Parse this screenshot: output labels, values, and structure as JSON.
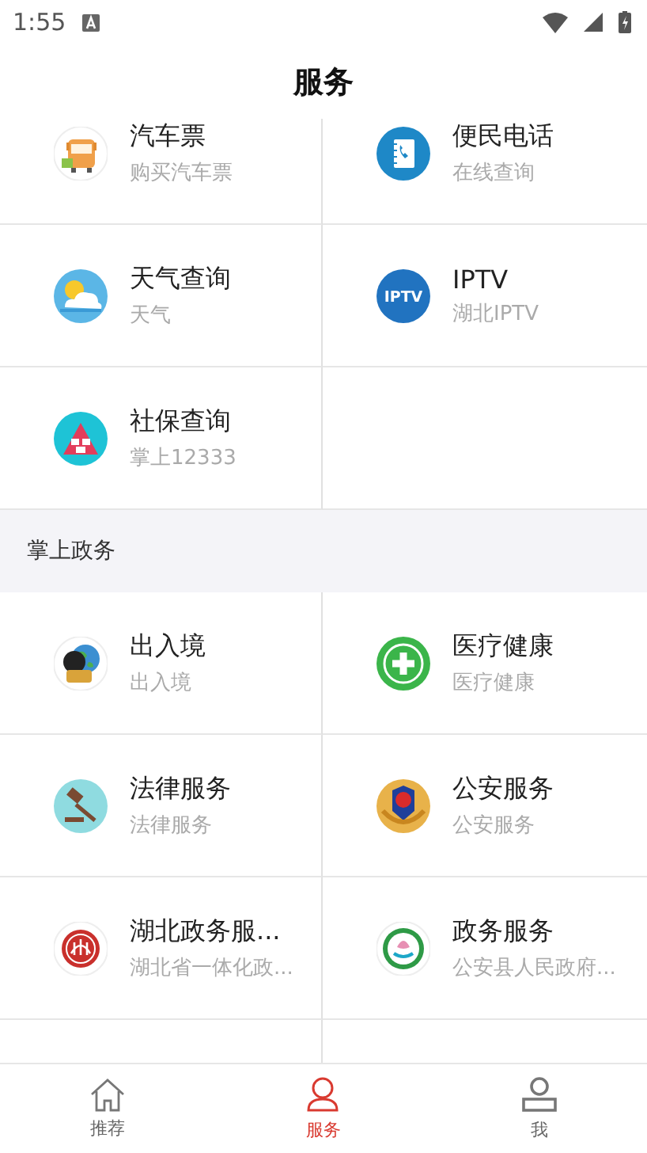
{
  "status_bar": {
    "time": "1:55"
  },
  "title": "服务",
  "sections": [
    {
      "items": [
        {
          "title": "汽车票",
          "subtitle": "购买汽车票",
          "kind": "bus"
        },
        {
          "title": "便民电话",
          "subtitle": "在线查询",
          "kind": "phone"
        },
        {
          "title": "天气查询",
          "subtitle": "天气",
          "kind": "weather"
        },
        {
          "title": "IPTV",
          "subtitle": "湖北IPTV",
          "kind": "iptv",
          "icon_text": "IPTV"
        },
        {
          "title": "社保查询",
          "subtitle": "掌上12333",
          "kind": "shebao"
        }
      ]
    },
    {
      "header": "掌上政务",
      "items": [
        {
          "title": "出入境",
          "subtitle": "出入境",
          "kind": "passport"
        },
        {
          "title": "医疗健康",
          "subtitle": "医疗健康",
          "kind": "medical"
        },
        {
          "title": "法律服务",
          "subtitle": "法律服务",
          "kind": "gavel"
        },
        {
          "title": "公安服务",
          "subtitle": "公安服务",
          "kind": "police"
        },
        {
          "title": "湖北政务服...",
          "subtitle": "湖北省一体化政...",
          "kind": "hubei"
        },
        {
          "title": "政务服务",
          "subtitle": "公安县人民政府...",
          "kind": "gov"
        }
      ]
    }
  ],
  "tabs": [
    {
      "label": "推荐",
      "kind": "home",
      "selected": false
    },
    {
      "label": "服务",
      "kind": "person",
      "selected": true
    },
    {
      "label": "我",
      "kind": "user",
      "selected": false
    }
  ]
}
